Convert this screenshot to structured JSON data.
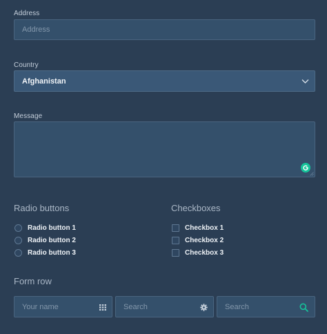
{
  "address": {
    "label": "Address",
    "placeholder": "Address"
  },
  "country": {
    "label": "Country",
    "selected": "Afghanistan",
    "icon": "chevron-down-icon"
  },
  "message": {
    "label": "Message",
    "value": "",
    "assist_icon": "grammarly-icon",
    "assist_color": "#15c39a"
  },
  "radios": {
    "title": "Radio buttons",
    "items": [
      {
        "label": "Radio button 1",
        "checked": false
      },
      {
        "label": "Radio button 2",
        "checked": false
      },
      {
        "label": "Radio button 3",
        "checked": false
      }
    ]
  },
  "checkboxes": {
    "title": "Checkboxes",
    "items": [
      {
        "label": "Checkbox 1",
        "checked": false
      },
      {
        "label": "Checkbox 2",
        "checked": false
      },
      {
        "label": "Checkbox 3",
        "checked": false
      }
    ]
  },
  "form_row": {
    "title": "Form row",
    "name_placeholder": "Your name",
    "name_icon": "grid-icon",
    "search1_placeholder": "Search",
    "search1_icon": "gear-icon",
    "search2_placeholder": "Search",
    "search2_icon": "search-icon",
    "accent": "#15c39a"
  }
}
